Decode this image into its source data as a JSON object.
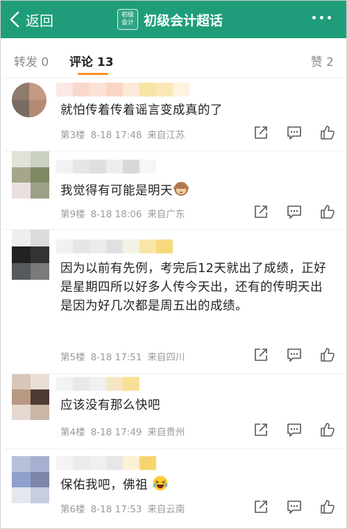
{
  "header": {
    "back_label": "返回",
    "logo_line1": "初级",
    "logo_line2": "会计",
    "title": "初级会计超话",
    "bg_color": "#1f9d7a"
  },
  "tabs": {
    "repost": "转发 0",
    "comments": "评论 13",
    "likes": "赞 2",
    "active_color": "#ff8c1a"
  },
  "icons": [
    "chevron-left-icon",
    "more-dots-icon",
    "share-icon",
    "reply-icon",
    "like-icon",
    "monkey-emoji-icon",
    "laughing-emoji-icon"
  ],
  "comments": [
    {
      "text": "就怕传着传着谣言变成真的了",
      "floor": "第3楼",
      "time": "8-18 17:48",
      "location": "来自江苏"
    },
    {
      "text": "我觉得有可能是明天",
      "floor": "第9楼",
      "time": "8-18 18:06",
      "location": "来自广东"
    },
    {
      "text": "因为以前有先例，考完后12天就出了成绩，正好是星期四所以好多人传今天出，还有的传明天出是因为好几次都是周五出的成绩。",
      "floor": "第5楼",
      "time": "8-18 17:51",
      "location": "来自四川"
    },
    {
      "text": "应该没有那么快吧",
      "floor": "第4楼",
      "time": "8-18 17:49",
      "location": "来自贵州"
    },
    {
      "text": "保佑我吧，佛祖",
      "floor": "第6楼",
      "time": "8-18 17:53",
      "location": "来自云南"
    }
  ]
}
